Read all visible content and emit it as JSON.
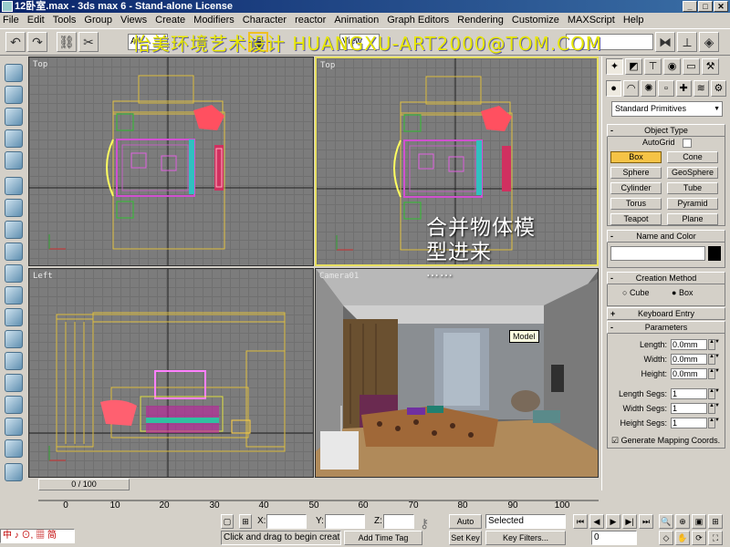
{
  "window": {
    "title": "12卧室.max - 3ds max 6 - Stand-alone License",
    "buttons": [
      "_",
      "□",
      "✕"
    ]
  },
  "menu": [
    "File",
    "Edit",
    "Tools",
    "Group",
    "Views",
    "Create",
    "Modifiers",
    "Character",
    "reactor",
    "Animation",
    "Graph Editors",
    "Rendering",
    "Customize",
    "MAXScript",
    "Help"
  ],
  "toolbar": {
    "selection_filter": "All",
    "ref_coord": "View"
  },
  "watermark": "怡美环境艺术设计 HUANGXU-ART2000@TOM.COM",
  "viewports": {
    "top_left": "Top",
    "top_right": "Top",
    "bottom_left": "Left",
    "bottom_right": "Camera01"
  },
  "overlay_text": {
    "line1": "合并物体模",
    "line2": "型进来",
    "line3": "……"
  },
  "tooltip": "Model",
  "command_panel": {
    "dropdown": "Standard Primitives",
    "object_type": {
      "title": "Object Type",
      "autogrid": "AutoGrid",
      "buttons": [
        "Box",
        "Cone",
        "Sphere",
        "GeoSphere",
        "Cylinder",
        "Tube",
        "Torus",
        "Pyramid",
        "Teapot",
        "Plane"
      ],
      "selected": "Box"
    },
    "name_color": {
      "title": "Name and Color"
    },
    "creation_method": {
      "title": "Creation Method",
      "options": [
        "Cube",
        "Box"
      ],
      "selected": "Box"
    },
    "keyboard_entry": {
      "title": "Keyboard Entry"
    },
    "parameters": {
      "title": "Parameters",
      "length_label": "Length:",
      "length": "0.0mm",
      "width_label": "Width:",
      "width": "0.0mm",
      "height_label": "Height:",
      "height": "0.0mm",
      "length_segs_label": "Length Segs:",
      "length_segs": "1",
      "width_segs_label": "Width Segs:",
      "width_segs": "1",
      "height_segs_label": "Height Segs:",
      "height_segs": "1",
      "gen_map": "Generate Mapping Coords."
    }
  },
  "timeline": {
    "frame_display": "0 / 100",
    "ticks": [
      "0",
      "10",
      "20",
      "30",
      "40",
      "50",
      "60",
      "70",
      "80",
      "90",
      "100"
    ]
  },
  "status": {
    "prompt": "Click and drag to begin creation pro",
    "add_time_tag": "Add Time Tag",
    "x_label": "X:",
    "y_label": "Y:",
    "z_label": "Z:",
    "auto_key": "Auto Key",
    "set_key": "Set Key",
    "key_mode": "Selected",
    "key_filters": "Key Filters...",
    "current_frame": "0",
    "ime": "中 ♪ ⊙, ▦ 简"
  },
  "colors": {
    "active_border": "#e8e060",
    "selected_button": "#f5c346",
    "title_bar": "#0a246a",
    "watermark": "#e8e800"
  }
}
